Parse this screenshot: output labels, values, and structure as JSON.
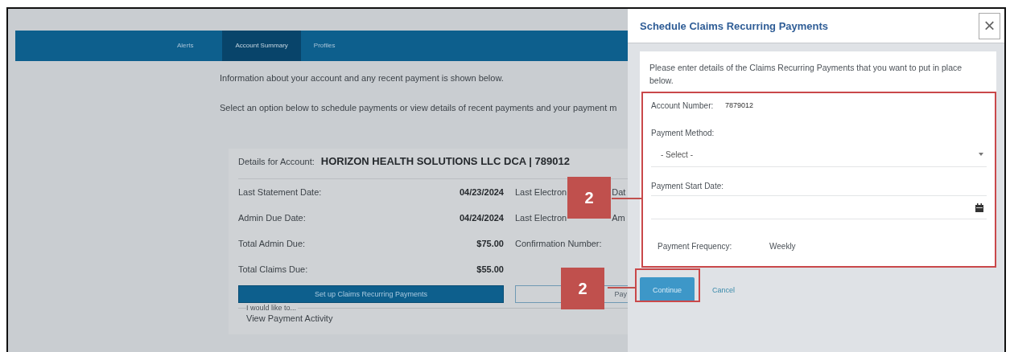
{
  "nav": {
    "tabs": [
      {
        "label": "Alerts",
        "selected": false
      },
      {
        "label": "Account Summary",
        "selected": true
      },
      {
        "label": "Profiles",
        "selected": false
      }
    ]
  },
  "intro": [
    "Information about your account and any recent payment is shown below.",
    "Select an option below to schedule payments or view details of recent payments and your payment m"
  ],
  "account": {
    "label": "Details for Account:",
    "name": "HORIZON HEALTH SOLUTIONS LLC DCA | 789012",
    "rows": [
      {
        "label": "Last Statement Date:",
        "value": "04/23/2024",
        "right_label": "Last Electron",
        "right_tail": "Dat"
      },
      {
        "label": "Admin Due Date:",
        "value": "04/24/2024",
        "right_label": "Last Electron",
        "right_tail": "Am"
      },
      {
        "label": "Total Admin Due:",
        "value": "$75.00",
        "right_label": "Confirmation Number:"
      },
      {
        "label": "Total Claims Due:",
        "value": "$55.00"
      }
    ],
    "primary_button": "Set up Claims Recurring Payments",
    "secondary_button": "Pay",
    "options": {
      "legend": "I would like to...",
      "value": "View Payment Activity"
    }
  },
  "dialog": {
    "title": "Schedule Claims Recurring Payments",
    "close": "×",
    "intro": "Please enter details of the Claims Recurring Payments that you want to put in place below.",
    "fields": [
      {
        "kind": "inline",
        "label": "Account Number:",
        "value": "7879012"
      },
      {
        "kind": "select",
        "label": "Payment Method:",
        "value": "- Select -"
      },
      {
        "kind": "date",
        "label": "Payment Start Date:"
      },
      {
        "kind": "inline",
        "label": "Payment Frequency:",
        "value": "Weekly"
      }
    ],
    "buttons": [
      {
        "kind": "primary",
        "label": "Continue"
      },
      {
        "kind": "link",
        "label": "Cancel"
      }
    ]
  },
  "callouts": [
    "2",
    "2"
  ]
}
